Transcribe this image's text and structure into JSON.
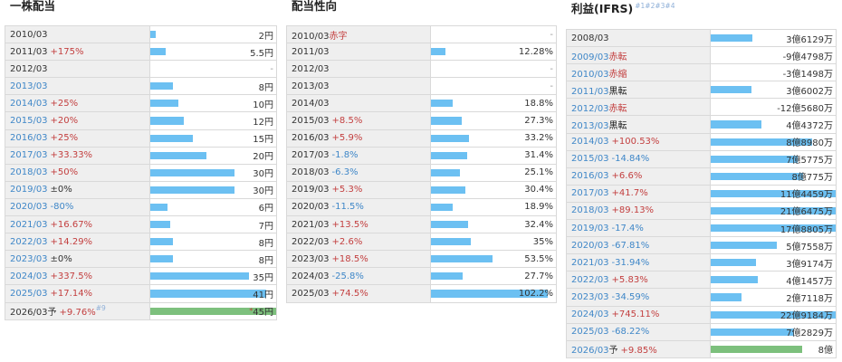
{
  "colors": {
    "bar": "#6cc0f2",
    "forecast_bar": "#7dc07d",
    "positive": "#c33f3f",
    "negative": "#3f87c8",
    "label_bg": "#efefef"
  },
  "panels": [
    {
      "title": "一株配当",
      "title_sup": "",
      "value_scale_max": 45,
      "rows": [
        {
          "year": "2010/03",
          "yblue": false,
          "change": "",
          "ctype": "",
          "note": "",
          "ntype": "",
          "value": 2,
          "value_text": "2円",
          "ref": "",
          "forecast": false
        },
        {
          "year": "2011/03",
          "yblue": false,
          "change": "+175%",
          "ctype": "pos",
          "note": "",
          "ntype": "",
          "value": 5.5,
          "value_text": "5.5円",
          "ref": "",
          "forecast": false
        },
        {
          "year": "2012/03",
          "yblue": false,
          "change": "",
          "ctype": "",
          "note": "",
          "ntype": "",
          "value": 0,
          "value_text": "-",
          "ref": "",
          "forecast": false
        },
        {
          "year": "2013/03",
          "yblue": true,
          "change": "",
          "ctype": "",
          "note": "",
          "ntype": "",
          "value": 8,
          "value_text": "8円",
          "ref": "",
          "forecast": false
        },
        {
          "year": "2014/03",
          "yblue": true,
          "change": "+25%",
          "ctype": "pos",
          "note": "",
          "ntype": "",
          "value": 10,
          "value_text": "10円",
          "ref": "",
          "forecast": false
        },
        {
          "year": "2015/03",
          "yblue": true,
          "change": "+20%",
          "ctype": "pos",
          "note": "",
          "ntype": "",
          "value": 12,
          "value_text": "12円",
          "ref": "",
          "forecast": false
        },
        {
          "year": "2016/03",
          "yblue": true,
          "change": "+25%",
          "ctype": "pos",
          "note": "",
          "ntype": "",
          "value": 15,
          "value_text": "15円",
          "ref": "",
          "forecast": false
        },
        {
          "year": "2017/03",
          "yblue": true,
          "change": "+33.33%",
          "ctype": "pos",
          "note": "",
          "ntype": "",
          "value": 20,
          "value_text": "20円",
          "ref": "",
          "forecast": false
        },
        {
          "year": "2018/03",
          "yblue": true,
          "change": "+50%",
          "ctype": "pos",
          "note": "",
          "ntype": "",
          "value": 30,
          "value_text": "30円",
          "ref": "",
          "forecast": false
        },
        {
          "year": "2019/03",
          "yblue": true,
          "change": "±0%",
          "ctype": "neu",
          "note": "",
          "ntype": "",
          "value": 30,
          "value_text": "30円",
          "ref": "",
          "forecast": false
        },
        {
          "year": "2020/03",
          "yblue": true,
          "change": "-80%",
          "ctype": "neg",
          "note": "",
          "ntype": "",
          "value": 6,
          "value_text": "6円",
          "ref": "",
          "forecast": false
        },
        {
          "year": "2021/03",
          "yblue": true,
          "change": "+16.67%",
          "ctype": "pos",
          "note": "",
          "ntype": "",
          "value": 7,
          "value_text": "7円",
          "ref": "",
          "forecast": false
        },
        {
          "year": "2022/03",
          "yblue": true,
          "change": "+14.29%",
          "ctype": "pos",
          "note": "",
          "ntype": "",
          "value": 8,
          "value_text": "8円",
          "ref": "",
          "forecast": false
        },
        {
          "year": "2023/03",
          "yblue": true,
          "change": "±0%",
          "ctype": "neu",
          "note": "",
          "ntype": "",
          "value": 8,
          "value_text": "8円",
          "ref": "",
          "forecast": false
        },
        {
          "year": "2024/03",
          "yblue": true,
          "change": "+337.5%",
          "ctype": "pos",
          "note": "",
          "ntype": "",
          "value": 35,
          "value_text": "35円",
          "ref": "",
          "forecast": false
        },
        {
          "year": "2025/03",
          "yblue": true,
          "change": "+17.14%",
          "ctype": "pos",
          "note": "",
          "ntype": "",
          "value": 41,
          "value_text": "41円",
          "ref": "",
          "forecast": false
        },
        {
          "year": "2026/03",
          "yblue": false,
          "change": "+9.76%",
          "ctype": "pos",
          "note": "",
          "ntype": "",
          "value": 45,
          "value_text": "45円",
          "ref": "#9",
          "ref_pre": "予",
          "forecast": true,
          "value_mark": "*"
        }
      ]
    },
    {
      "title": "配当性向",
      "title_sup": "",
      "value_scale_max": 110,
      "rows": [
        {
          "year": "2010/03",
          "yblue": false,
          "change": "",
          "ctype": "",
          "note": "赤字",
          "ntype": "red",
          "value": 0,
          "value_text": "-",
          "ref": "",
          "forecast": false
        },
        {
          "year": "2011/03",
          "yblue": false,
          "change": "",
          "ctype": "",
          "note": "",
          "ntype": "",
          "value": 12.28,
          "value_text": "12.28%",
          "ref": "",
          "forecast": false
        },
        {
          "year": "2012/03",
          "yblue": false,
          "change": "",
          "ctype": "",
          "note": "",
          "ntype": "",
          "value": 0,
          "value_text": "-",
          "ref": "",
          "forecast": false
        },
        {
          "year": "2013/03",
          "yblue": false,
          "change": "",
          "ctype": "",
          "note": "",
          "ntype": "",
          "value": 0,
          "value_text": "-",
          "ref": "",
          "forecast": false
        },
        {
          "year": "2014/03",
          "yblue": false,
          "change": "",
          "ctype": "",
          "note": "",
          "ntype": "",
          "value": 18.8,
          "value_text": "18.8%",
          "ref": "",
          "forecast": false
        },
        {
          "year": "2015/03",
          "yblue": false,
          "change": "+8.5%",
          "ctype": "pos",
          "note": "",
          "ntype": "",
          "value": 27.3,
          "value_text": "27.3%",
          "ref": "",
          "forecast": false
        },
        {
          "year": "2016/03",
          "yblue": false,
          "change": "+5.9%",
          "ctype": "pos",
          "note": "",
          "ntype": "",
          "value": 33.2,
          "value_text": "33.2%",
          "ref": "",
          "forecast": false
        },
        {
          "year": "2017/03",
          "yblue": false,
          "change": "-1.8%",
          "ctype": "neg",
          "note": "",
          "ntype": "",
          "value": 31.4,
          "value_text": "31.4%",
          "ref": "",
          "forecast": false
        },
        {
          "year": "2018/03",
          "yblue": false,
          "change": "-6.3%",
          "ctype": "neg",
          "note": "",
          "ntype": "",
          "value": 25.1,
          "value_text": "25.1%",
          "ref": "",
          "forecast": false
        },
        {
          "year": "2019/03",
          "yblue": false,
          "change": "+5.3%",
          "ctype": "pos",
          "note": "",
          "ntype": "",
          "value": 30.4,
          "value_text": "30.4%",
          "ref": "",
          "forecast": false
        },
        {
          "year": "2020/03",
          "yblue": false,
          "change": "-11.5%",
          "ctype": "neg",
          "note": "",
          "ntype": "",
          "value": 18.9,
          "value_text": "18.9%",
          "ref": "",
          "forecast": false
        },
        {
          "year": "2021/03",
          "yblue": false,
          "change": "+13.5%",
          "ctype": "pos",
          "note": "",
          "ntype": "",
          "value": 32.4,
          "value_text": "32.4%",
          "ref": "",
          "forecast": false
        },
        {
          "year": "2022/03",
          "yblue": false,
          "change": "+2.6%",
          "ctype": "pos",
          "note": "",
          "ntype": "",
          "value": 35,
          "value_text": "35%",
          "ref": "",
          "forecast": false
        },
        {
          "year": "2023/03",
          "yblue": false,
          "change": "+18.5%",
          "ctype": "pos",
          "note": "",
          "ntype": "",
          "value": 53.5,
          "value_text": "53.5%",
          "ref": "",
          "forecast": false
        },
        {
          "year": "2024/03",
          "yblue": false,
          "change": "-25.8%",
          "ctype": "neg",
          "note": "",
          "ntype": "",
          "value": 27.7,
          "value_text": "27.7%",
          "ref": "",
          "forecast": false
        },
        {
          "year": "2025/03",
          "yblue": false,
          "change": "+74.5%",
          "ctype": "pos",
          "note": "",
          "ntype": "",
          "value": 102.2,
          "value_text": "102.2%",
          "ref": "",
          "forecast": false
        }
      ]
    },
    {
      "title": "利益(IFRS)",
      "title_sup": "#1#2#3#4",
      "value_scale_max": 110000,
      "rows": [
        {
          "year": "2008/03",
          "yblue": false,
          "change": "",
          "ctype": "",
          "note": "",
          "ntype": "",
          "value": 36129,
          "value_text": "3億6129万",
          "ref": "",
          "forecast": false
        },
        {
          "year": "2009/03",
          "yblue": true,
          "change": "",
          "ctype": "",
          "note": "赤転",
          "ntype": "red",
          "value": -94798,
          "value_text": "-9億4798万",
          "ref": "",
          "forecast": false
        },
        {
          "year": "2010/03",
          "yblue": true,
          "change": "",
          "ctype": "",
          "note": "赤縮",
          "ntype": "red",
          "value": -31498,
          "value_text": "-3億1498万",
          "ref": "",
          "forecast": false
        },
        {
          "year": "2011/03",
          "yblue": true,
          "change": "",
          "ctype": "",
          "note": "黒転",
          "ntype": "dark",
          "value": 36002,
          "value_text": "3億6002万",
          "ref": "",
          "forecast": false
        },
        {
          "year": "2012/03",
          "yblue": true,
          "change": "",
          "ctype": "",
          "note": "赤転",
          "ntype": "red",
          "value": -125680,
          "value_text": "-12億5680万",
          "ref": "",
          "forecast": false
        },
        {
          "year": "2013/03",
          "yblue": true,
          "change": "",
          "ctype": "",
          "note": "黒転",
          "ntype": "dark",
          "value": 44372,
          "value_text": "4億4372万",
          "ref": "",
          "forecast": false
        },
        {
          "year": "2014/03",
          "yblue": true,
          "change": "+100.53%",
          "ctype": "pos",
          "note": "",
          "ntype": "",
          "value": 88980,
          "value_text": "8億8980万",
          "ref": "",
          "forecast": false
        },
        {
          "year": "2015/03",
          "yblue": true,
          "change": "-14.84%",
          "ctype": "neg",
          "note": "",
          "ntype": "",
          "value": 75775,
          "value_text": "7億5775万",
          "ref": "",
          "forecast": false
        },
        {
          "year": "2016/03",
          "yblue": true,
          "change": "+6.6%",
          "ctype": "pos",
          "note": "",
          "ntype": "",
          "value": 80775,
          "value_text": "8億775万",
          "ref": "",
          "forecast": false
        },
        {
          "year": "2017/03",
          "yblue": true,
          "change": "+41.7%",
          "ctype": "pos",
          "note": "",
          "ntype": "",
          "value": 114459,
          "value_text": "11億4459万",
          "ref": "",
          "forecast": false
        },
        {
          "year": "2018/03",
          "yblue": true,
          "change": "+89.13%",
          "ctype": "pos",
          "note": "",
          "ntype": "",
          "value": 216475,
          "value_text": "21億6475万",
          "ref": "",
          "forecast": false
        },
        {
          "year": "2019/03",
          "yblue": true,
          "change": "-17.4%",
          "ctype": "neg",
          "note": "",
          "ntype": "",
          "value": 178805,
          "value_text": "17億8805万",
          "ref": "",
          "forecast": false
        },
        {
          "year": "2020/03",
          "yblue": true,
          "change": "-67.81%",
          "ctype": "neg",
          "note": "",
          "ntype": "",
          "value": 57558,
          "value_text": "5億7558万",
          "ref": "",
          "forecast": false
        },
        {
          "year": "2021/03",
          "yblue": true,
          "change": "-31.94%",
          "ctype": "neg",
          "note": "",
          "ntype": "",
          "value": 39174,
          "value_text": "3億9174万",
          "ref": "",
          "forecast": false
        },
        {
          "year": "2022/03",
          "yblue": true,
          "change": "+5.83%",
          "ctype": "pos",
          "note": "",
          "ntype": "",
          "value": 41457,
          "value_text": "4億1457万",
          "ref": "",
          "forecast": false
        },
        {
          "year": "2023/03",
          "yblue": true,
          "change": "-34.59%",
          "ctype": "neg",
          "note": "",
          "ntype": "",
          "value": 27118,
          "value_text": "2億7118万",
          "ref": "",
          "forecast": false
        },
        {
          "year": "2024/03",
          "yblue": true,
          "change": "+745.11%",
          "ctype": "pos",
          "note": "",
          "ntype": "",
          "value": 229184,
          "value_text": "22億9184万",
          "ref": "",
          "forecast": false
        },
        {
          "year": "2025/03",
          "yblue": true,
          "change": "-68.22%",
          "ctype": "neg",
          "note": "",
          "ntype": "",
          "value": 72829,
          "value_text": "7億2829万",
          "ref": "",
          "forecast": false
        },
        {
          "year": "2026/03",
          "yblue": true,
          "change": "+9.85%",
          "ctype": "pos",
          "note": "",
          "ntype": "",
          "value": 80000,
          "value_text": "8億",
          "ref": "",
          "ref_pre": "予",
          "forecast": true
        }
      ]
    }
  ]
}
